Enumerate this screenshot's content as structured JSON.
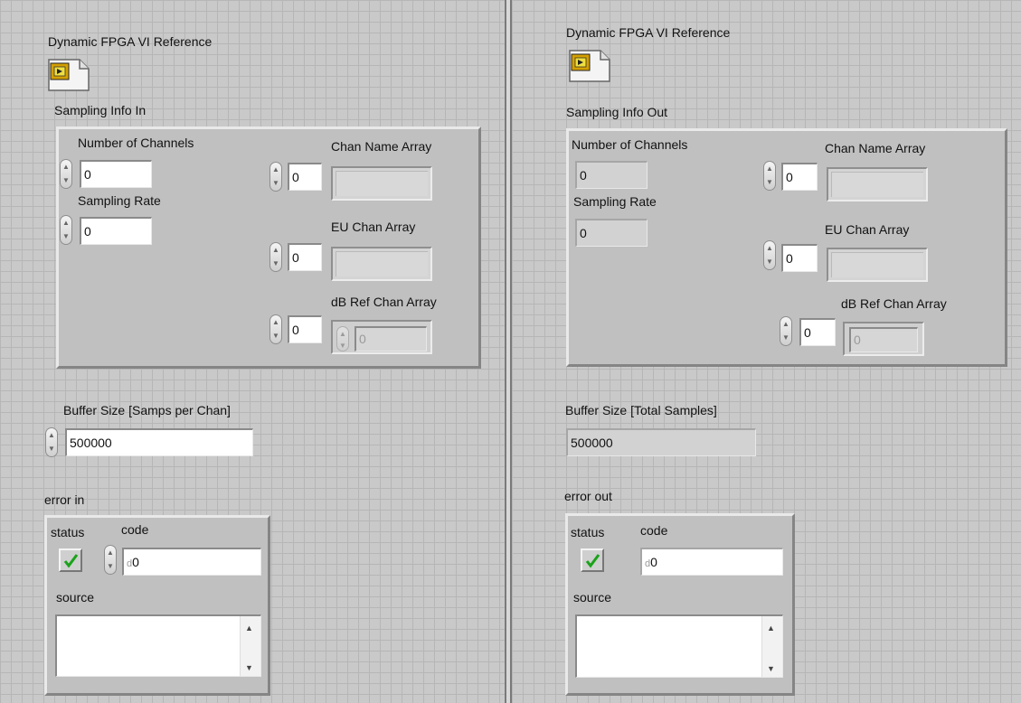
{
  "left": {
    "vi_ref_label": "Dynamic FPGA VI Reference",
    "cluster_label": "Sampling Info In",
    "num_channels_label": "Number of Channels",
    "num_channels_value": "0",
    "sampling_rate_label": "Sampling Rate",
    "sampling_rate_value": "0",
    "chan_name_label": "Chan Name Array",
    "chan_name_index": "0",
    "eu_chan_label": "EU Chan Array",
    "eu_chan_index": "0",
    "db_ref_label": "dB Ref Chan Array",
    "db_ref_index": "0",
    "db_ref_element": "0",
    "buffer_label": "Buffer Size [Samps per Chan]",
    "buffer_value": "500000",
    "error_label": "error in",
    "status_label": "status",
    "code_label": "code",
    "code_value": "0",
    "source_label": "source"
  },
  "right": {
    "vi_ref_label": "Dynamic FPGA VI Reference",
    "cluster_label": "Sampling Info Out",
    "num_channels_label": "Number of Channels",
    "num_channels_value": "0",
    "sampling_rate_label": "Sampling Rate",
    "sampling_rate_value": "0",
    "chan_name_label": "Chan Name Array",
    "chan_name_index": "0",
    "eu_chan_label": "EU Chan Array",
    "eu_chan_index": "0",
    "db_ref_label": "dB Ref Chan Array",
    "db_ref_index": "0",
    "db_ref_element": "0",
    "buffer_label": "Buffer Size [Total Samples]",
    "buffer_value": "500000",
    "error_label": "error out",
    "status_label": "status",
    "code_label": "code",
    "code_value": "0",
    "source_label": "source"
  },
  "icons": {
    "vi_reference": "fpga-vi-reference-icon",
    "status": "checkmark-icon",
    "spinner": "increment-decrement-icon",
    "scroll_up": "scroll-up-arrow-icon",
    "scroll_down": "scroll-down-arrow-icon"
  },
  "colors": {
    "background": "#c9c9c9",
    "grid": "#b6b6b6",
    "check_green": "#1aa31a"
  }
}
